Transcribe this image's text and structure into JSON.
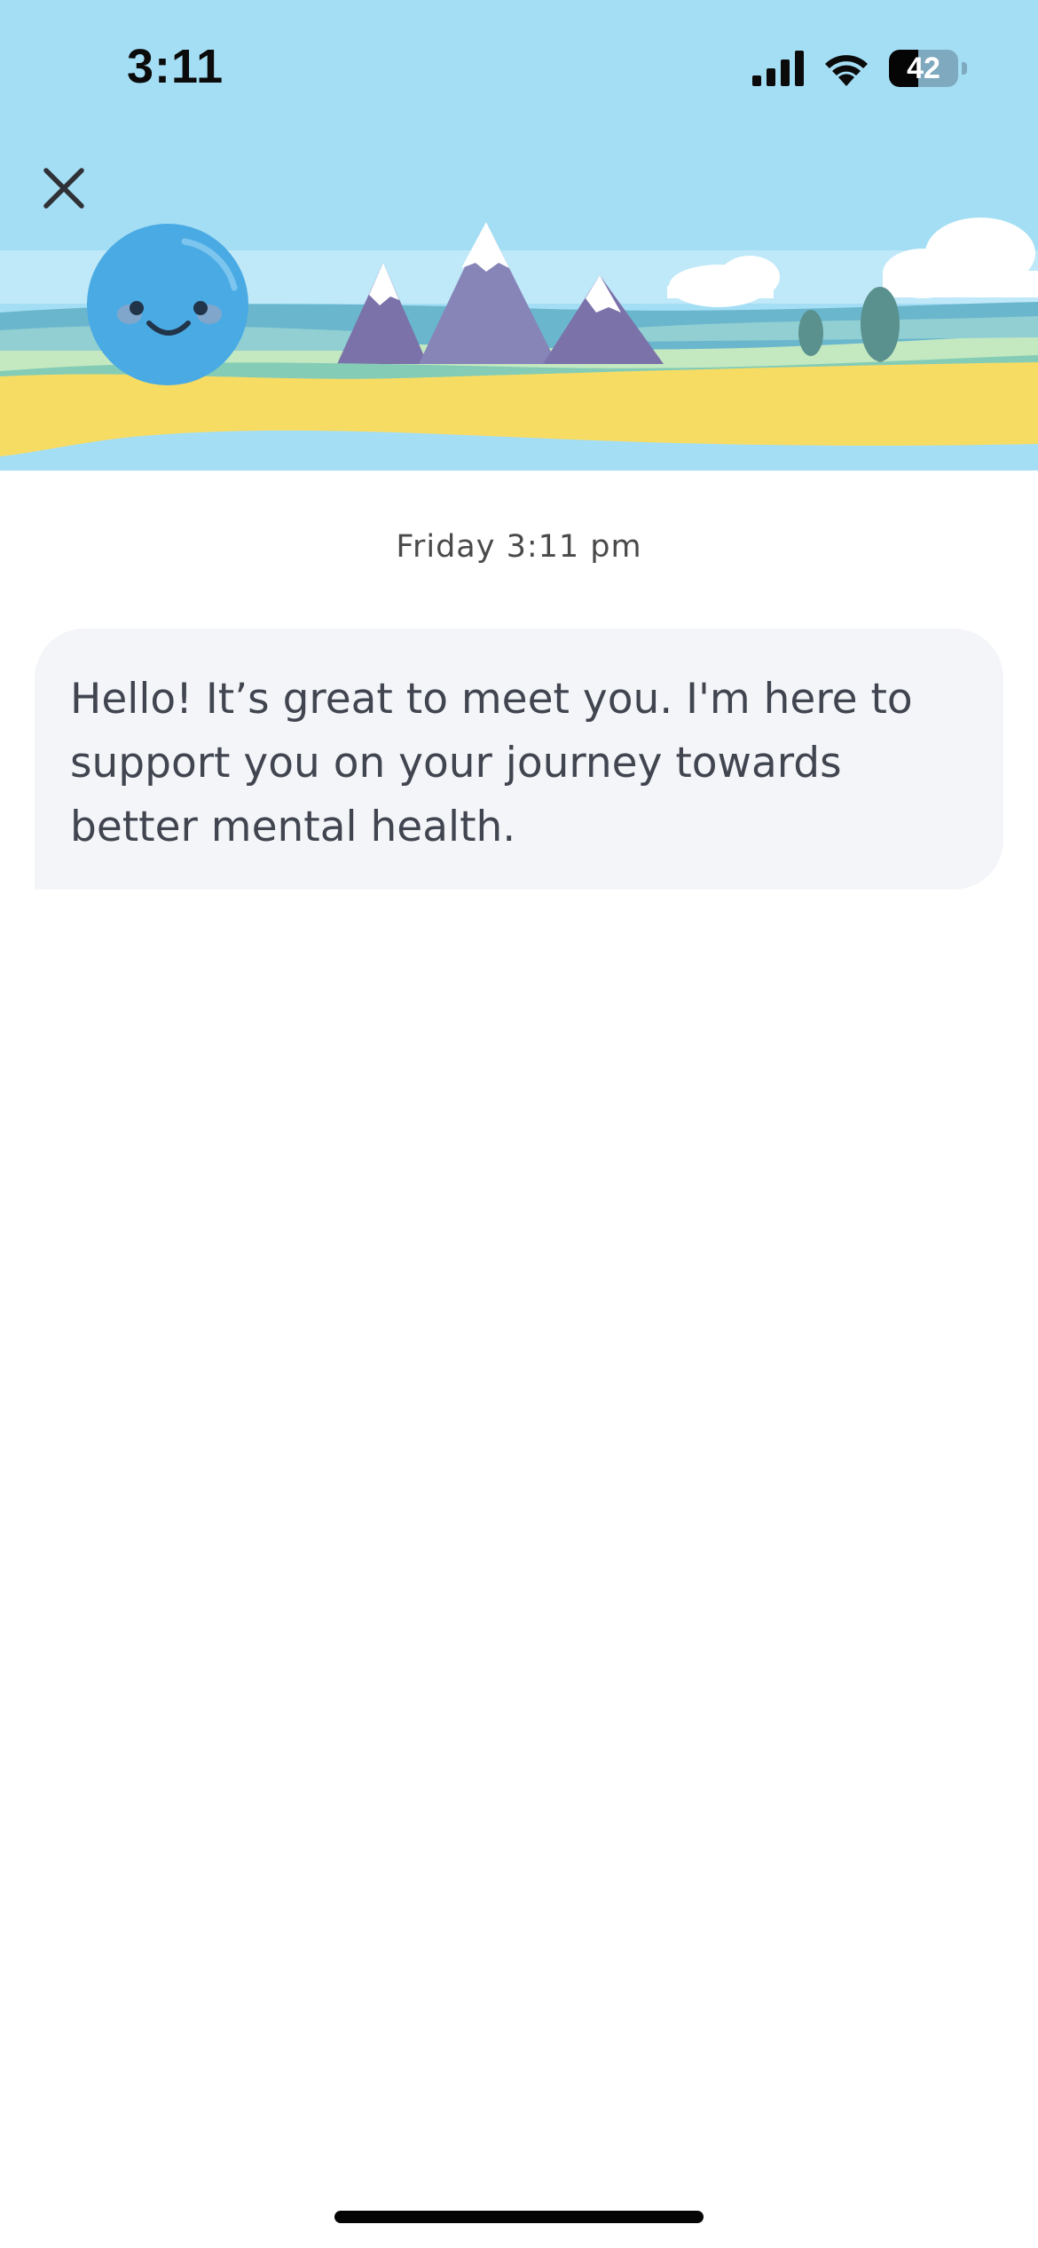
{
  "status_bar": {
    "time": "3:11",
    "battery_level": "42",
    "battery_fraction": 0.42,
    "icons": [
      "cellular-signal-icon",
      "wifi-icon",
      "battery-icon"
    ]
  },
  "header": {
    "close_icon": "close-icon",
    "avatar_icon": "smiley-face-icon"
  },
  "chat": {
    "timestamp": "Friday 3:11 pm",
    "messages": [
      {
        "sender": "bot",
        "text": "Hello! It’s great to meet you. I'm here to support you on your journey towards better mental health."
      }
    ]
  },
  "colors": {
    "sky": "#a4def4",
    "sand": "#f7dc64",
    "avatar": "#4aaae3",
    "bubble": "#f3f5f8",
    "text": "#414550"
  }
}
